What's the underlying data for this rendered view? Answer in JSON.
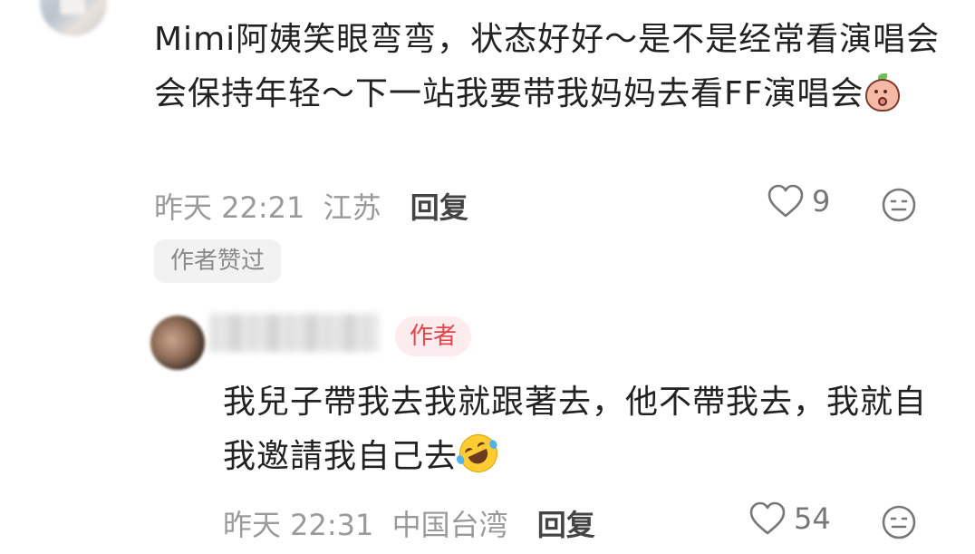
{
  "comment1": {
    "text": "Mimi阿姨笑眼弯弯，状态好好～是不是经常看演唱会会保持年轻～下一站我要带我妈妈去看FF演唱会",
    "emoji": "peach-shy-emoji",
    "time": "昨天 22:21",
    "location": "江苏",
    "reply_label": "回复",
    "likes": "9",
    "author_liked_label": "作者赞过"
  },
  "comment2": {
    "author_tag": "作者",
    "text": "我兒子帶我去我就跟著去，他不帶我去，我就自我邀請我自己去",
    "emoji": "rolling-on-floor-laughing-emoji",
    "time": "昨天 22:31",
    "location": "中国台湾",
    "reply_label": "回复",
    "likes": "54"
  },
  "colors": {
    "text": "#222222",
    "meta": "#9a9a9a",
    "author_tag_bg": "#fdecee",
    "author_tag_fg": "#e8424a",
    "pill_bg": "#f2f2f2"
  }
}
